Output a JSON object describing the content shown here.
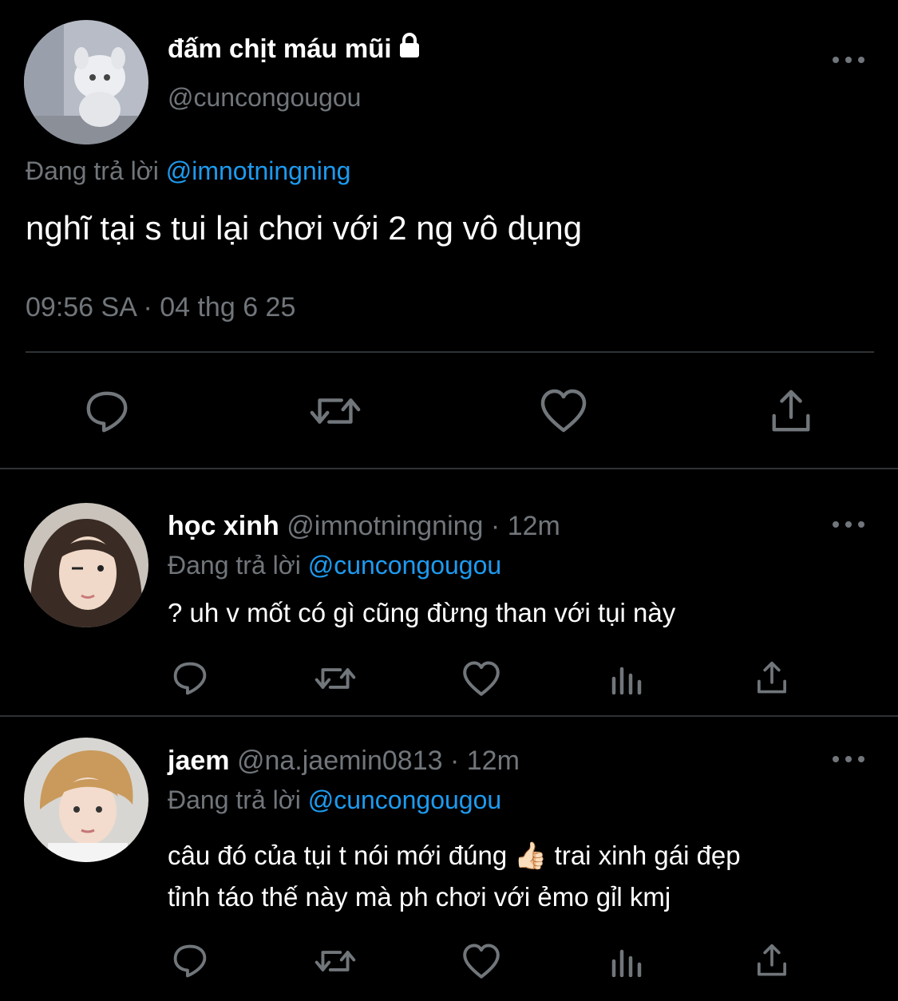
{
  "main_tweet": {
    "display_name": "đấm chịt máu mũi",
    "handle": "@cuncongougou",
    "replying_prefix": "Đang trả lời",
    "replying_to": "@imnotningning",
    "text": "nghĩ tại s tui lại chơi với 2 ng vô dụng",
    "timestamp": "09:56 SA · 04 thg 6 25",
    "icons": [
      "lock-icon",
      "more-icon",
      "reply-icon",
      "retweet-icon",
      "like-icon",
      "share-icon"
    ]
  },
  "replies": [
    {
      "display_name": "học xinh",
      "handle": "@imnotningning",
      "separator": " · ",
      "time": "12m",
      "replying_prefix": "Đang trả lời",
      "replying_to": "@cuncongougou",
      "text_lines": [
        "? uh v mốt có gì cũng đừng than với tụi này"
      ]
    },
    {
      "display_name": "jaem",
      "handle": "@na.jaemin0813",
      "separator": " · ",
      "time": "12m",
      "replying_prefix": "Đang trả lời",
      "replying_to": "@cuncongougou",
      "text_lines": [
        "câu đó của tụi t nói mới đúng 👍🏻  trai xinh gái đẹp",
        "tỉnh táo thế này mà ph chơi với ẻmo gỉl kmj"
      ]
    }
  ],
  "colors": {
    "background": "#000000",
    "text": "#ffffff",
    "secondary": "#71767b",
    "link": "#1d9bf0",
    "divider": "#2f3336"
  }
}
